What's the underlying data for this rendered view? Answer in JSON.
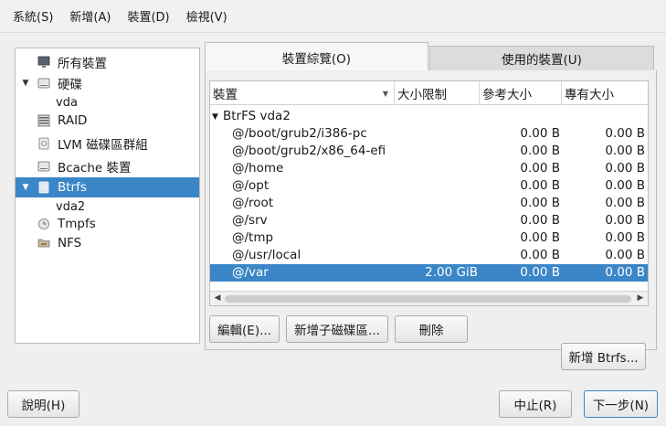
{
  "menu": [
    {
      "label": "系統(S)"
    },
    {
      "label": "新增(A)"
    },
    {
      "label": "裝置(D)"
    },
    {
      "label": "檢視(V)"
    }
  ],
  "tree": {
    "all_devices": "所有裝置",
    "disks": "硬碟",
    "disks_child": "vda",
    "raid": "RAID",
    "lvm": "LVM 磁碟區群組",
    "bcache": "Bcache 裝置",
    "btrfs": "Btrfs",
    "btrfs_child": "vda2",
    "tmpfs": "Tmpfs",
    "nfs": "NFS"
  },
  "tabs": {
    "overview": "裝置綜覽(O)",
    "used_devices": "使用的裝置(U)"
  },
  "table": {
    "headers": [
      "裝置",
      "大小限制",
      "參考大小",
      "專有大小"
    ],
    "group": "BtrFS vda2",
    "rows": [
      {
        "device": "@/boot/grub2/i386-pc",
        "limit": "",
        "ref": "0.00 B",
        "excl": "0.00 B"
      },
      {
        "device": "@/boot/grub2/x86_64-efi",
        "limit": "",
        "ref": "0.00 B",
        "excl": "0.00 B"
      },
      {
        "device": "@/home",
        "limit": "",
        "ref": "0.00 B",
        "excl": "0.00 B"
      },
      {
        "device": "@/opt",
        "limit": "",
        "ref": "0.00 B",
        "excl": "0.00 B"
      },
      {
        "device": "@/root",
        "limit": "",
        "ref": "0.00 B",
        "excl": "0.00 B"
      },
      {
        "device": "@/srv",
        "limit": "",
        "ref": "0.00 B",
        "excl": "0.00 B"
      },
      {
        "device": "@/tmp",
        "limit": "",
        "ref": "0.00 B",
        "excl": "0.00 B"
      },
      {
        "device": "@/usr/local",
        "limit": "",
        "ref": "0.00 B",
        "excl": "0.00 B"
      },
      {
        "device": "@/var",
        "limit": "2.00 GiB",
        "ref": "0.00 B",
        "excl": "0.00 B"
      }
    ]
  },
  "buttons": {
    "edit": "編輯(E)...",
    "add_subvolume": "新增子磁碟區...",
    "delete": "刪除",
    "add_btrfs": "新增 Btrfs...",
    "help": "說明(H)",
    "abort": "中止(R)",
    "next": "下一步(N)"
  },
  "colors": {
    "selection": "#3b86c7"
  }
}
